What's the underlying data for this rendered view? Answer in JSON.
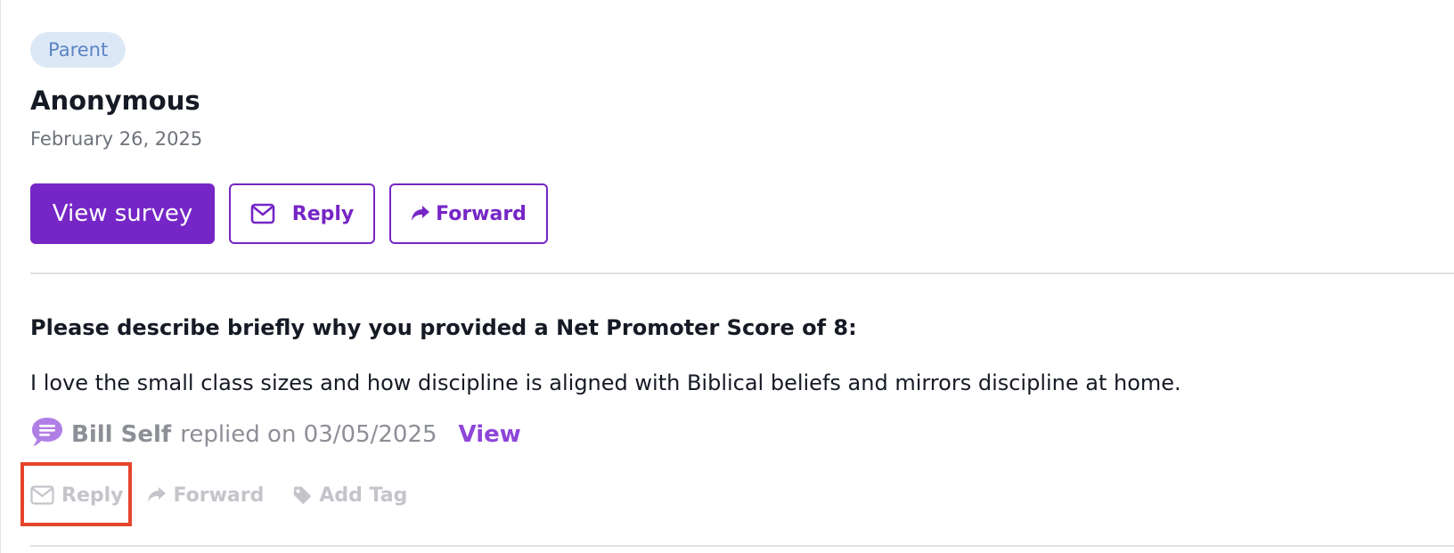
{
  "response": {
    "role_badge": "Parent",
    "author": "Anonymous",
    "date": "February 26, 2025"
  },
  "buttons": {
    "view_survey": "View survey",
    "reply": "Reply",
    "forward": "Forward"
  },
  "question": {
    "prompt": "Please describe briefly why you provided a Net Promoter Score of 8:",
    "answer": "I love the small class sizes and how discipline is aligned with Biblical beliefs and mirrors discipline at home."
  },
  "reply_info": {
    "replier": "Bill Self",
    "text": "replied on 03/05/2025",
    "view_link": "View"
  },
  "actions": {
    "reply": "Reply",
    "forward": "Forward",
    "add_tag": "Add Tag"
  },
  "icons": {
    "envelope": "envelope-icon",
    "forward": "share-arrow-icon",
    "tag": "tag-icon",
    "comment": "chat-bubble-icon"
  },
  "colors": {
    "accent": "#7626c6",
    "link": "#8e45d9",
    "highlight": "#e5452c",
    "badge_bg": "#dde8f6",
    "badge_text": "#5b84c4",
    "muted": "#c4c5ca"
  }
}
